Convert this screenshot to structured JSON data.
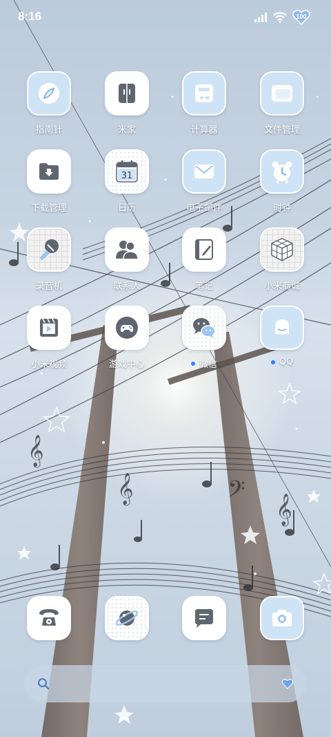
{
  "status_bar": {
    "time": "8:16",
    "battery_level": "100",
    "icons": [
      "signal-icon",
      "wifi-icon",
      "battery-heart-icon"
    ]
  },
  "apps": [
    {
      "label": "指南针",
      "icon": "compass-icon",
      "style": "blue"
    },
    {
      "label": "米家",
      "icon": "mijia-icon",
      "style": "white"
    },
    {
      "label": "计算器",
      "icon": "calculator-icon",
      "style": "blue"
    },
    {
      "label": "文件管理",
      "icon": "folder-icon",
      "style": "blue"
    },
    {
      "label": "下载管理",
      "icon": "download-icon",
      "style": "white"
    },
    {
      "label": "日历",
      "icon": "calendar-icon",
      "style": "white",
      "icon_text": "31"
    },
    {
      "label": "电子邮件",
      "icon": "mail-icon",
      "style": "blue"
    },
    {
      "label": "时钟",
      "icon": "alarm-clock-icon",
      "style": "blue"
    },
    {
      "label": "录音机",
      "icon": "microphone-icon",
      "style": "grid"
    },
    {
      "label": "联系人",
      "icon": "contacts-icon",
      "style": "white"
    },
    {
      "label": "笔记",
      "icon": "notes-icon",
      "style": "white"
    },
    {
      "label": "小米商城",
      "icon": "store-cube-icon",
      "style": "grid"
    },
    {
      "label": "小米视频",
      "icon": "video-icon",
      "style": "white"
    },
    {
      "label": "游戏中心",
      "icon": "gamepad-icon",
      "style": "white"
    },
    {
      "label": "微信",
      "icon": "wechat-icon",
      "style": "dots",
      "notification": true
    },
    {
      "label": "QQ",
      "icon": "qq-icon",
      "style": "blue",
      "notification": true
    }
  ],
  "dock": [
    {
      "name": "phone",
      "icon": "phone-icon"
    },
    {
      "name": "browser",
      "icon": "browser-planet-icon"
    },
    {
      "name": "messages",
      "icon": "message-icon"
    },
    {
      "name": "camera",
      "icon": "camera-icon"
    }
  ],
  "search_bar": {
    "icons": [
      "search-icon",
      "heart-icon"
    ]
  },
  "colors": {
    "icon_blue_bg": "#cfe3f6",
    "glyph_gray": "#5f6670",
    "glyph_blue": "#7eb4e8",
    "notification_dot": "#3a7dff"
  }
}
